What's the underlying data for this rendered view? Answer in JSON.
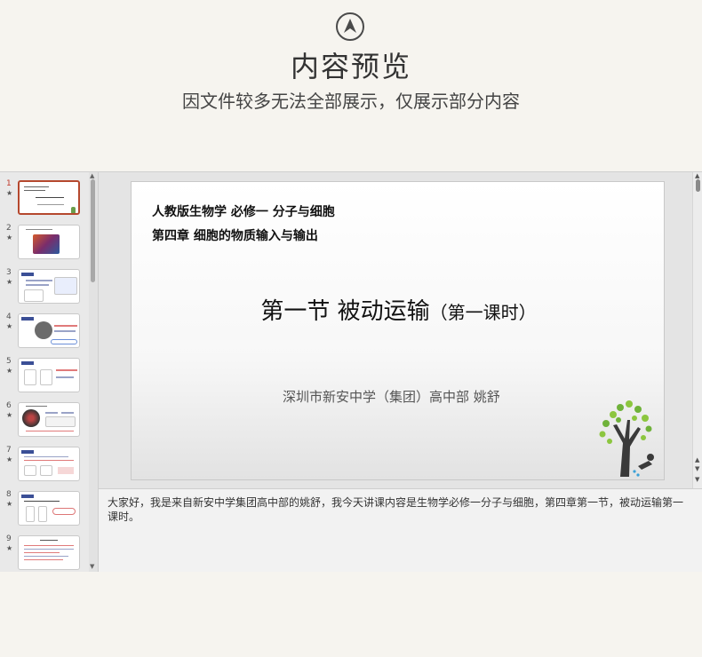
{
  "header": {
    "title": "内容预览",
    "subtitle": "因文件较多无法全部展示，仅展示部分内容"
  },
  "thumbnails": [
    {
      "num": "1",
      "star": "★",
      "active": true
    },
    {
      "num": "2",
      "star": "★"
    },
    {
      "num": "3",
      "star": "★"
    },
    {
      "num": "4",
      "star": "★"
    },
    {
      "num": "5",
      "star": "★"
    },
    {
      "num": "6",
      "star": "★"
    },
    {
      "num": "7",
      "star": "★"
    },
    {
      "num": "8",
      "star": "★"
    },
    {
      "num": "9",
      "star": "★"
    }
  ],
  "slide": {
    "line1": "人教版生物学  必修一  分子与细胞",
    "line2": "第四章   细胞的物质输入与输出",
    "title_main": "第一节 被动运输",
    "title_sub": "（第一课时）",
    "author": "深圳市新安中学（集团）高中部    姚舒"
  },
  "notes": {
    "text": "大家好，我是来自新安中学集团高中部的姚舒，我今天讲课内容是生物学必修一分子与细胞，第四章第一节，被动运输第一课时。"
  },
  "colors": {
    "active_thumb_border": "#b5482e",
    "page_bg": "#f6f4ef"
  }
}
